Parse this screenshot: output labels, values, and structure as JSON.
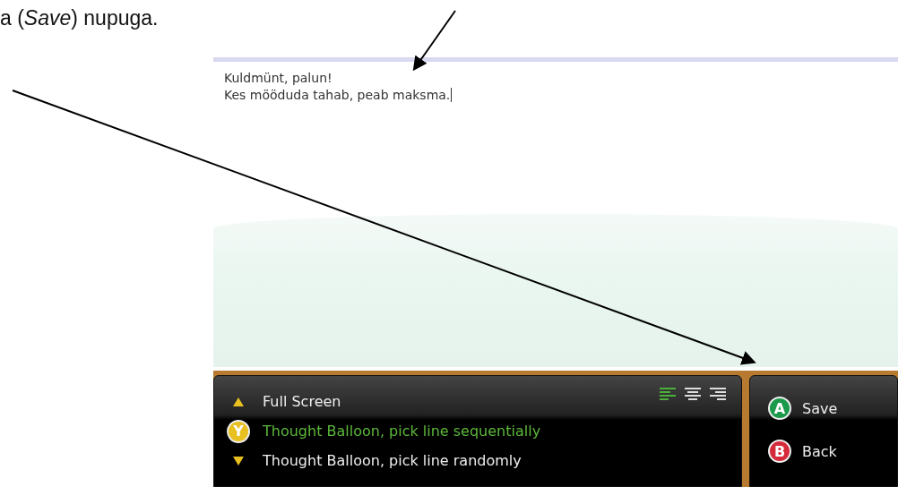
{
  "document_text": "a (*Save*) nupuga.",
  "editor": {
    "lines": [
      "Kuldmünt, palun!",
      "Kes mööduda tahab, peab maksma."
    ]
  },
  "options": [
    {
      "kind": "up",
      "label": "Full Screen",
      "selected": false
    },
    {
      "kind": "y",
      "badge": "Y",
      "label": "Thought Balloon, pick line sequentially",
      "selected": true
    },
    {
      "kind": "down",
      "label": "Thought Balloon, pick line randomly",
      "selected": false
    }
  ],
  "alignments": [
    {
      "kind": "left",
      "selected": true
    },
    {
      "kind": "center",
      "selected": false
    },
    {
      "kind": "right",
      "selected": false
    }
  ],
  "actions": [
    {
      "badge": "A",
      "label": "Save",
      "color": "#1a9a4a"
    },
    {
      "badge": "B",
      "label": "Back",
      "color": "#d42a3a"
    }
  ]
}
